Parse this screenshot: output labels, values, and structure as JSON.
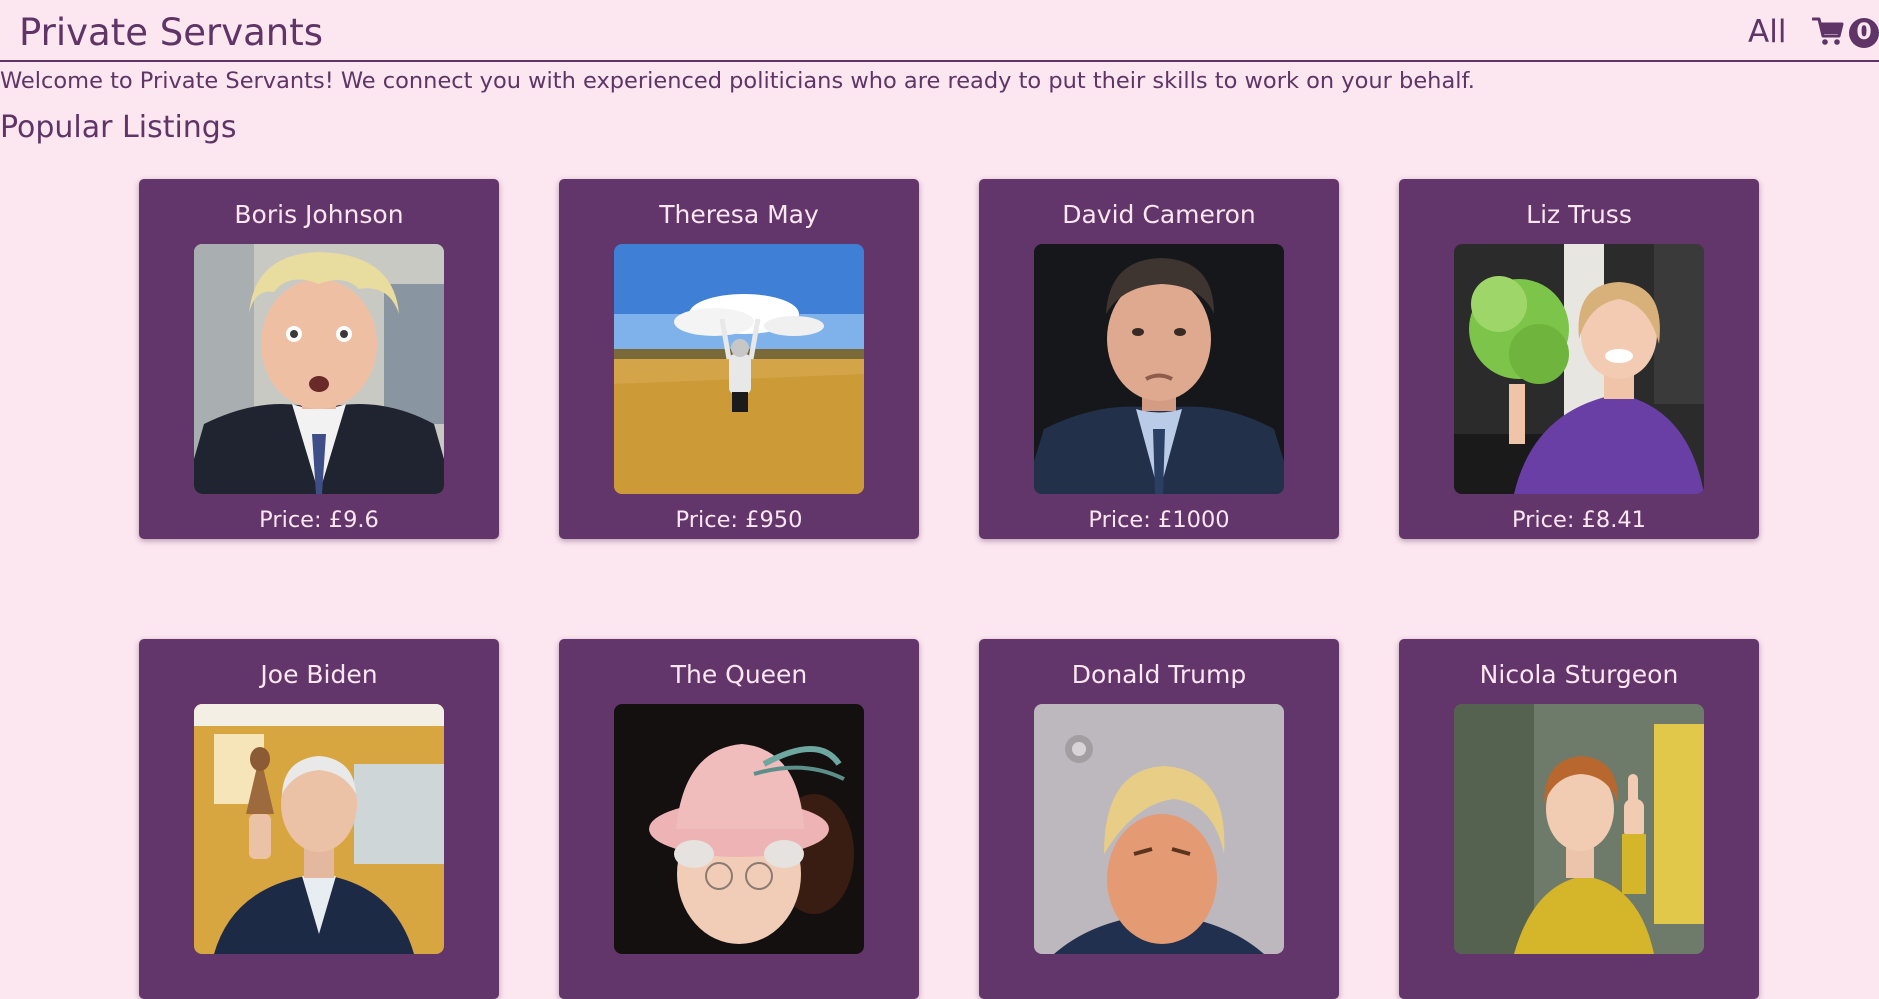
{
  "header": {
    "brand": "Private Servants",
    "nav_all": "All",
    "cart_icon": "cart-icon",
    "cart_count": "0"
  },
  "welcome": "Welcome to Private Servants! We connect you with experienced politicians who are ready to put their skills to work on your behalf.",
  "section_title": "Popular Listings",
  "colors": {
    "background": "#fce6f0",
    "card": "#62366a",
    "text": "#5e3566",
    "card_text": "#fce6f0"
  },
  "listings": [
    {
      "name": "Boris Johnson",
      "price": "Price: £9.6",
      "photo": "boris-johnson-photo"
    },
    {
      "name": "Theresa May",
      "price": "Price: £950",
      "photo": "theresa-may-photo"
    },
    {
      "name": "David Cameron",
      "price": "Price: £1000",
      "photo": "david-cameron-photo"
    },
    {
      "name": "Liz Truss",
      "price": "Price: £8.41",
      "photo": "liz-truss-photo"
    },
    {
      "name": "Joe Biden",
      "price": "",
      "photo": "joe-biden-photo"
    },
    {
      "name": "The Queen",
      "price": "",
      "photo": "the-queen-photo"
    },
    {
      "name": "Donald Trump",
      "price": "",
      "photo": "donald-trump-photo"
    },
    {
      "name": "Nicola Sturgeon",
      "price": "",
      "photo": "nicola-sturgeon-photo"
    }
  ]
}
